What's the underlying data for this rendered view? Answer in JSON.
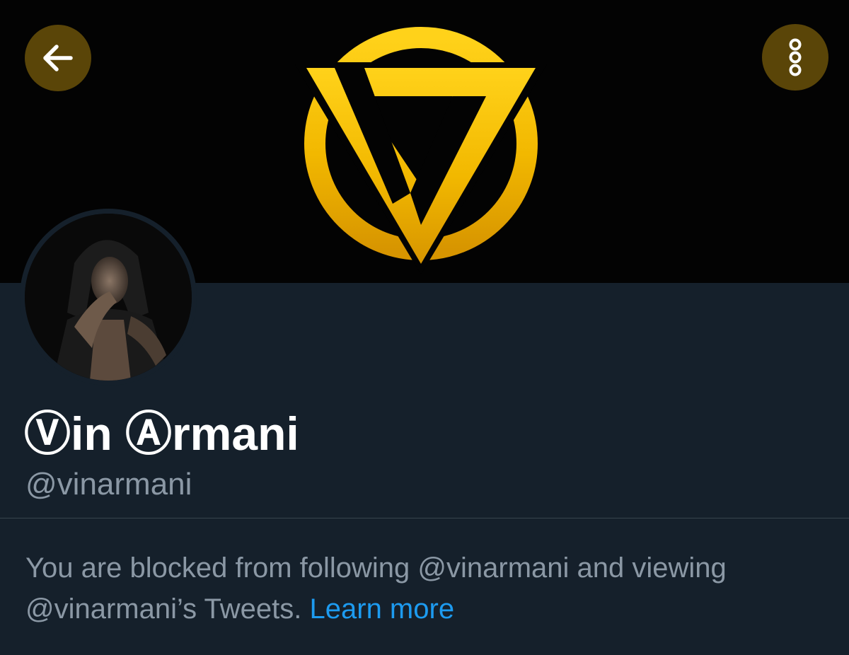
{
  "header": {
    "back_icon": "arrow-left-icon",
    "more_icon": "more-vertical-icon",
    "button_bg": "#5a4508"
  },
  "banner": {
    "background": "#030303",
    "logo_color": "#f2c200",
    "logo_icon": "gold-v-triangle-logo"
  },
  "profile": {
    "display_name": "Ⓥin Ⓐrmani",
    "handle": "@vinarmani",
    "avatar": "hooded-man-avatar"
  },
  "blocked": {
    "message": "You are blocked from following @vinarmani and viewing @vinarmani’s Tweets.",
    "learn_more": "Learn more",
    "link_color": "#1d9bf0"
  },
  "theme": {
    "background": "#15202b",
    "text_primary": "#ffffff",
    "text_secondary": "#8b98a5",
    "divider": "#38444d"
  }
}
